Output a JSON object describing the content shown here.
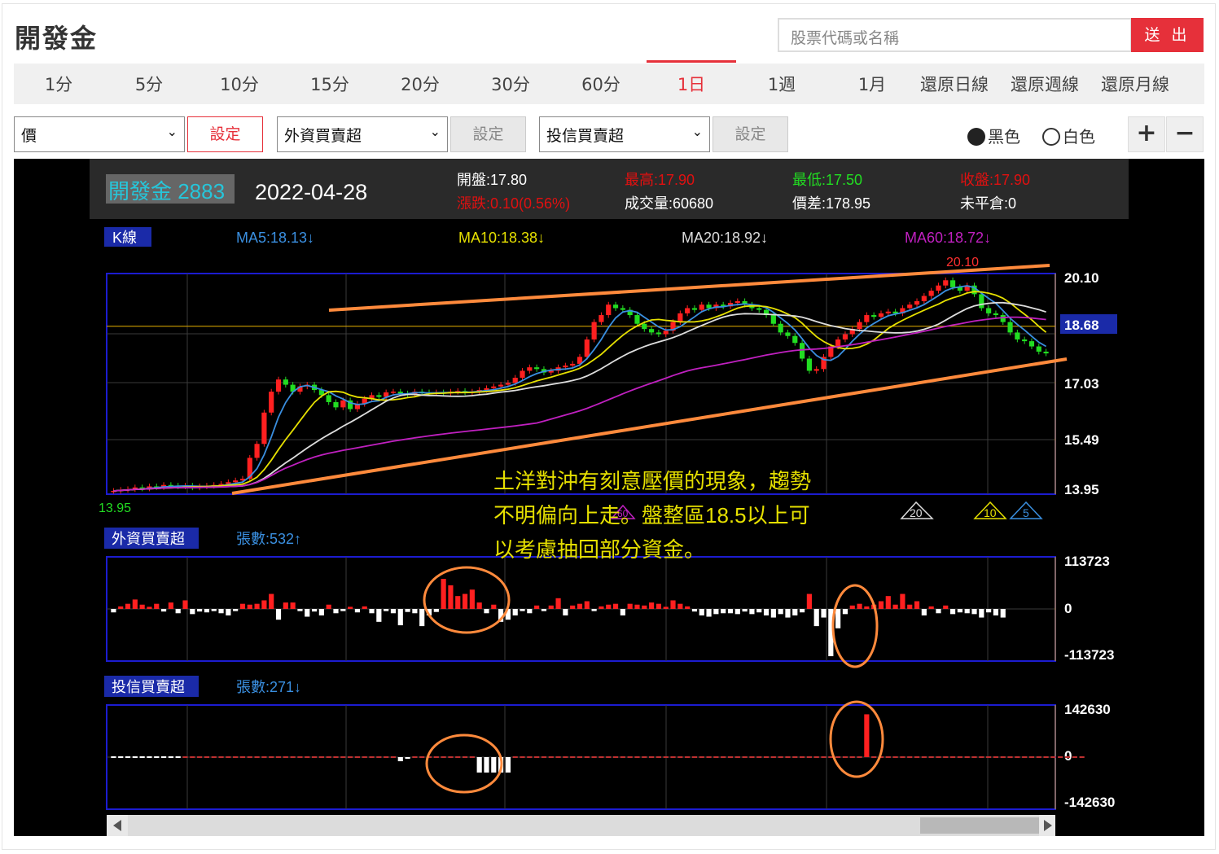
{
  "page": {
    "title": "開發金"
  },
  "search": {
    "placeholder": "股票代碼或名稱",
    "submit_label": "送 出"
  },
  "tabs": [
    {
      "label": "1分"
    },
    {
      "label": "5分"
    },
    {
      "label": "10分"
    },
    {
      "label": "15分"
    },
    {
      "label": "20分"
    },
    {
      "label": "30分"
    },
    {
      "label": "60分"
    },
    {
      "label": "1日",
      "active": true
    },
    {
      "label": "1週"
    },
    {
      "label": "1月"
    },
    {
      "label": "還原日線"
    },
    {
      "label": "還原週線"
    },
    {
      "label": "還原月線"
    }
  ],
  "controls": {
    "select1": "價",
    "set1": "設定",
    "select2": "外資買賣超",
    "set2": "設定",
    "select3": "投信買賣超",
    "set3": "設定",
    "theme_black": "黑色",
    "theme_white": "白色",
    "zoom_in": "+",
    "zoom_out": "−"
  },
  "header": {
    "name": "開發金 2883",
    "date": "2022-04-28",
    "open": "開盤:17.80",
    "change": "漲跌:0.10(0.56%)",
    "high": "最高:17.90",
    "volume": "成交量:60680",
    "low": "最低:17.50",
    "spread": "價差:178.95",
    "close": "收盤:17.90",
    "unfilled": "未平倉:0"
  },
  "colors": {
    "up": "#ff2020",
    "down": "#22dd22",
    "ma5": "#3a8fe0",
    "ma10": "#e6e000",
    "ma20": "#dddddd",
    "ma60": "#c020c0",
    "annotation": "#ff8a3c"
  },
  "panels": {
    "k": {
      "label": "K線",
      "ma5": "MA5:18.13↓",
      "ma10": "MA10:18.38↓",
      "ma20": "MA20:18.92↓",
      "ma60": "MA60:18.72↓",
      "high_label": "20.10",
      "low_label": "13.95",
      "current": "18.68",
      "ticks": [
        "20.10",
        "18.68",
        "17.03",
        "15.49",
        "13.95"
      ],
      "markers": [
        "60",
        "20",
        "10",
        "5"
      ]
    },
    "foreign": {
      "label": "外資買賣超",
      "count": "張數:532↑",
      "ticks": [
        "113723",
        "0",
        "-113723"
      ]
    },
    "trust": {
      "label": "投信買賣超",
      "count": "張數:271↓",
      "ticks": [
        "142630",
        "0",
        "-142630"
      ]
    }
  },
  "annotation": {
    "line1": "土洋對沖有刻意壓價的現象，趨勢",
    "line2": "不明偏向上走。盤整區18.5以上可",
    "line3": "以考慮抽回部分資金。"
  },
  "chart_data": [
    {
      "type": "candlestick",
      "title": "K線",
      "ylim": [
        13.95,
        20.1
      ],
      "current_price": 18.68,
      "closes": [
        13.95,
        13.98,
        14.0,
        14.05,
        14.02,
        14.08,
        14.06,
        14.12,
        14.1,
        14.08,
        14.1,
        14.05,
        14.08,
        14.1,
        14.12,
        14.15,
        14.2,
        14.25,
        14.3,
        14.9,
        15.3,
        16.2,
        16.8,
        17.15,
        17.0,
        16.8,
        16.95,
        17.0,
        16.85,
        16.7,
        16.5,
        16.35,
        16.55,
        16.3,
        16.45,
        16.6,
        16.7,
        16.65,
        16.78,
        16.8,
        16.75,
        16.72,
        16.8,
        16.78,
        16.76,
        16.78,
        16.75,
        16.8,
        16.82,
        16.78,
        16.8,
        16.85,
        16.9,
        16.95,
        17.0,
        17.05,
        17.2,
        17.4,
        17.5,
        17.45,
        17.35,
        17.4,
        17.5,
        17.55,
        17.6,
        17.8,
        18.3,
        18.8,
        19.0,
        19.3,
        19.2,
        19.15,
        19.0,
        18.75,
        18.6,
        18.5,
        18.45,
        18.55,
        18.8,
        19.05,
        19.2,
        19.15,
        19.3,
        19.2,
        19.3,
        19.25,
        19.35,
        19.4,
        19.3,
        19.2,
        19.15,
        19.0,
        18.75,
        18.5,
        18.4,
        18.2,
        17.75,
        17.4,
        17.45,
        17.8,
        18.1,
        18.3,
        18.45,
        18.6,
        18.8,
        19.0,
        18.95,
        19.05,
        19.1,
        19.05,
        19.2,
        19.3,
        19.4,
        19.55,
        19.7,
        19.85,
        20.0,
        19.8,
        19.7,
        19.85,
        19.6,
        19.2,
        19.05,
        19.0,
        18.8,
        18.5,
        18.3,
        18.25,
        18.1,
        17.95,
        17.9
      ]
    },
    {
      "type": "bar",
      "title": "外資買賣超",
      "ylim": [
        -113723,
        113723
      ],
      "values": [
        -8000,
        6000,
        12000,
        22000,
        10000,
        5000,
        12000,
        -6000,
        15000,
        -10000,
        20000,
        -12000,
        -6000,
        -8000,
        -5000,
        -10000,
        -15000,
        -5000,
        12000,
        10000,
        12000,
        20000,
        35000,
        -25000,
        15000,
        15000,
        -5000,
        -18000,
        -6000,
        -15000,
        10000,
        -10000,
        -5000,
        5000,
        -8000,
        6000,
        -10000,
        -30000,
        -5000,
        -10000,
        -38000,
        -7000,
        -10000,
        -40000,
        -15000,
        -7000,
        70000,
        55000,
        30000,
        35000,
        45000,
        15000,
        -10000,
        10000,
        -30000,
        -25000,
        -15000,
        -5000,
        -10000,
        8000,
        -5000,
        8000,
        25000,
        -15000,
        8000,
        12000,
        18000,
        -5000,
        6000,
        10000,
        12000,
        -15000,
        12000,
        10000,
        8000,
        15000,
        12000,
        5000,
        20000,
        12000,
        6000,
        -6000,
        -15000,
        -18000,
        -12000,
        -10000,
        -10000,
        -12000,
        -6000,
        -12000,
        -8000,
        -15000,
        -20000,
        -12000,
        -20000,
        -15000,
        -8000,
        35000,
        -40000,
        -20000,
        -110000,
        -45000,
        -12000,
        8000,
        12000,
        6000,
        10000,
        18000,
        30000,
        10000,
        35000,
        10000,
        18000,
        -15000,
        6000,
        -10000,
        8000,
        -12000,
        -8000,
        -10000,
        -12000,
        -20000,
        -8000,
        -15000,
        -20000
      ]
    },
    {
      "type": "bar",
      "title": "投信買賣超",
      "ylim": [
        -142630,
        142630
      ],
      "values": [
        0,
        0,
        0,
        0,
        0,
        0,
        0,
        0,
        0,
        0,
        0,
        0,
        0,
        0,
        0,
        0,
        0,
        0,
        0,
        0,
        0,
        0,
        0,
        0,
        0,
        0,
        0,
        0,
        0,
        0,
        0,
        0,
        0,
        0,
        0,
        0,
        0,
        0,
        0,
        0,
        -12000,
        -5000,
        0,
        0,
        0,
        0,
        0,
        0,
        0,
        0,
        0,
        -45000,
        -45000,
        -45000,
        -45000,
        -45000,
        0,
        0,
        0,
        0,
        0,
        0,
        0,
        0,
        0,
        0,
        0,
        0,
        0,
        0,
        0,
        0,
        0,
        0,
        0,
        0,
        0,
        0,
        0,
        0,
        0,
        0,
        0,
        0,
        0,
        0,
        0,
        0,
        0,
        0,
        0,
        0,
        0,
        0,
        0,
        0,
        0,
        0,
        0,
        0,
        0,
        0,
        0,
        0,
        0,
        125000,
        0,
        0,
        0,
        0,
        0,
        0,
        0,
        0,
        0,
        0,
        0,
        0,
        0,
        0,
        0,
        0,
        0,
        0,
        0,
        0,
        0,
        0,
        0,
        0,
        0,
        0,
        0,
        0,
        0,
        0
      ]
    }
  ]
}
